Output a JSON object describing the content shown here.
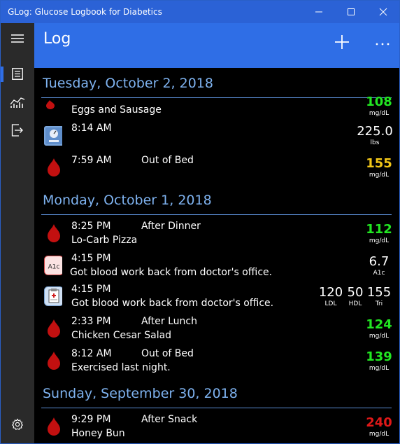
{
  "window": {
    "title": "GLog: Glucose Logbook for Diabetics"
  },
  "appbar": {
    "title": "Log"
  },
  "colors": {
    "accent": "#2f6ee6",
    "titlebar": "#2b62d6",
    "sidebar": "#2a2a2a",
    "header_text": "#7eb2ef",
    "good": "#22e622",
    "warn": "#f2c618",
    "high": "#e01818"
  },
  "days": [
    {
      "label": "Tuesday, October 2, 2018",
      "entries": [
        {
          "icon": "blood-drop-icon",
          "time": "",
          "tag": "",
          "note": "Eggs and Sausage",
          "value": "108",
          "unit": "mg/dL"
        },
        {
          "icon": "scale-icon",
          "time": "8:14 AM",
          "tag": "",
          "note": "",
          "value": "225.0",
          "unit": "lbs"
        },
        {
          "icon": "blood-drop-icon",
          "time": "7:59 AM",
          "tag": "Out of Bed",
          "note": "",
          "value": "155",
          "unit": "mg/dL"
        }
      ]
    },
    {
      "label": "Monday, October 1, 2018",
      "entries": [
        {
          "icon": "blood-drop-icon",
          "time": "8:25 PM",
          "tag": "After Dinner",
          "note": "Lo-Carb Pizza",
          "value": "112",
          "unit": "mg/dL"
        },
        {
          "icon": "a1c-icon",
          "icon_label": "A1c",
          "time": "4:15 PM",
          "tag": "",
          "note": "Got blood work back from doctor's office.",
          "value": "6.7",
          "unit": "A1c"
        },
        {
          "icon": "clipboard-icon",
          "time": "4:15 PM",
          "tag": "",
          "note": "Got blood work back from doctor's office.",
          "values": [
            {
              "value": "120",
              "unit": "LDL"
            },
            {
              "value": "50",
              "unit": "HDL"
            },
            {
              "value": "155",
              "unit": "Tri"
            }
          ]
        },
        {
          "icon": "blood-drop-icon",
          "time": "2:33 PM",
          "tag": "After Lunch",
          "note": "Chicken Cesar Salad",
          "value": "124",
          "unit": "mg/dL"
        },
        {
          "icon": "blood-drop-icon",
          "time": "8:12 AM",
          "tag": "Out of Bed",
          "note": "Exercised last night.",
          "value": "139",
          "unit": "mg/dL"
        }
      ]
    },
    {
      "label": "Sunday, September 30, 2018",
      "entries": [
        {
          "icon": "blood-drop-icon",
          "time": "9:29 PM",
          "tag": "After Snack",
          "note": "Honey Bun",
          "value": "240",
          "unit": "mg/dL"
        }
      ]
    }
  ]
}
